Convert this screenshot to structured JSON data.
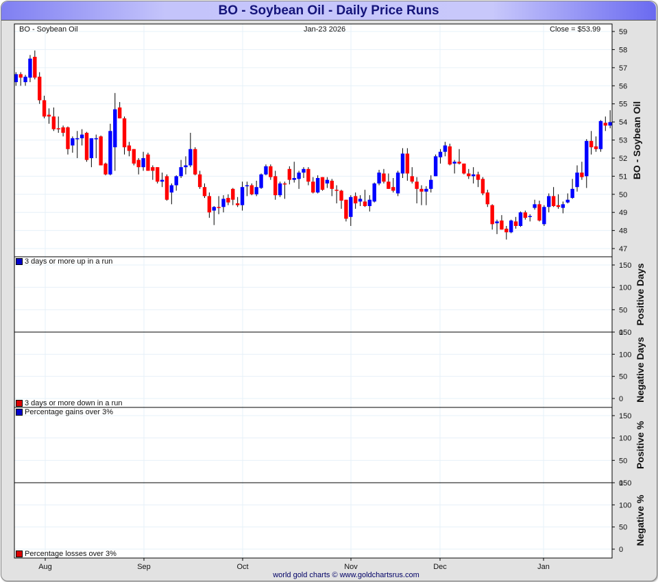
{
  "title": "BO  -  Soybean Oil - Daily Price Runs",
  "footer": "world gold charts © www.goldchartsrus.com",
  "chart_data": [
    {
      "type": "candlestick",
      "header_left": "BO  -  Soybean Oil",
      "header_center": "Jan-23  2026",
      "header_right": "Close = $53.99",
      "ylabel": "BO  -  Soybean Oil",
      "ylim": [
        47,
        59
      ],
      "y_ticks": [
        "47",
        "48",
        "49",
        "50",
        "51",
        "52",
        "53",
        "54",
        "55",
        "56",
        "57",
        "58",
        "59"
      ],
      "x_ticks": [
        "Aug",
        "Sep",
        "Oct",
        "Nov",
        "Dec",
        "Jan"
      ],
      "grid": true,
      "colors": {
        "up": "#0000ff",
        "down": "#ff0000",
        "grid": "#e6f0f8"
      },
      "ohlc": [
        [
          56.2,
          56.75,
          56.0,
          56.64
        ],
        [
          56.64,
          56.75,
          56.0,
          56.45
        ],
        [
          56.2,
          56.6,
          56.0,
          56.5
        ],
        [
          56.45,
          57.7,
          56.2,
          57.5
        ],
        [
          57.6,
          57.95,
          56.35,
          56.45
        ],
        [
          56.5,
          56.75,
          55.0,
          55.2
        ],
        [
          55.2,
          55.45,
          54.2,
          54.3
        ],
        [
          54.4,
          54.75,
          53.9,
          54.3
        ],
        [
          54.3,
          54.8,
          53.5,
          53.6
        ],
        [
          53.65,
          54.3,
          53.4,
          53.6
        ],
        [
          53.7,
          53.8,
          53.2,
          53.4
        ],
        [
          53.7,
          53.75,
          52.2,
          52.5
        ],
        [
          52.7,
          53.2,
          52.3,
          53.1
        ],
        [
          53.1,
          53.5,
          52.0,
          53.1
        ],
        [
          53.1,
          53.6,
          52.7,
          53.3
        ],
        [
          53.4,
          53.45,
          51.8,
          51.9
        ],
        [
          52.0,
          53.1,
          51.5,
          53.1
        ],
        [
          53.1,
          53.3,
          52.0,
          53.1
        ],
        [
          53.2,
          53.25,
          51.6,
          51.6
        ],
        [
          51.7,
          51.75,
          51.05,
          51.1
        ],
        [
          51.1,
          53.9,
          51.05,
          53.5
        ],
        [
          52.6,
          55.6,
          51.3,
          54.7
        ],
        [
          54.8,
          55.1,
          54.2,
          54.2
        ],
        [
          54.2,
          54.3,
          52.2,
          52.6
        ],
        [
          52.7,
          52.9,
          52.1,
          52.4
        ],
        [
          52.5,
          52.5,
          51.6,
          51.7
        ],
        [
          51.9,
          52.0,
          51.1,
          51.5
        ],
        [
          51.5,
          52.35,
          51.3,
          52.0
        ],
        [
          52.2,
          52.3,
          51.3,
          51.3
        ],
        [
          51.5,
          51.6,
          50.8,
          51.3
        ],
        [
          51.5,
          51.5,
          50.6,
          50.7
        ],
        [
          50.7,
          51.2,
          50.4,
          50.8
        ],
        [
          51.0,
          51.1,
          49.65,
          49.7
        ],
        [
          50.1,
          50.6,
          49.45,
          50.5
        ],
        [
          50.5,
          51.05,
          50.2,
          51.0
        ],
        [
          51.0,
          51.9,
          50.9,
          51.5
        ],
        [
          51.5,
          52.1,
          51.1,
          51.6
        ],
        [
          51.6,
          53.4,
          51.5,
          52.5
        ],
        [
          52.5,
          52.6,
          51.05,
          51.1
        ],
        [
          51.1,
          51.3,
          50.3,
          50.4
        ],
        [
          50.4,
          50.6,
          49.8,
          49.9
        ],
        [
          49.9,
          50.1,
          48.7,
          49.0
        ],
        [
          49.1,
          49.35,
          48.3,
          49.3
        ],
        [
          49.3,
          49.9,
          48.9,
          49.25
        ],
        [
          49.3,
          49.95,
          49.0,
          49.75
        ],
        [
          49.8,
          50.0,
          49.4,
          49.55
        ],
        [
          50.3,
          50.35,
          49.4,
          49.7
        ],
        [
          49.5,
          49.85,
          49.3,
          49.4
        ],
        [
          49.4,
          50.7,
          49.1,
          50.4
        ],
        [
          50.45,
          50.7,
          49.9,
          50.5
        ],
        [
          50.5,
          50.6,
          49.95,
          50.0
        ],
        [
          50.0,
          50.75,
          49.9,
          50.4
        ],
        [
          50.35,
          51.15,
          50.3,
          51.1
        ],
        [
          51.1,
          51.65,
          51.05,
          51.55
        ],
        [
          51.55,
          51.65,
          50.8,
          50.95
        ],
        [
          51.0,
          51.3,
          49.7,
          49.95
        ],
        [
          49.95,
          50.7,
          49.85,
          50.6
        ],
        [
          50.6,
          50.7,
          49.75,
          50.55
        ],
        [
          51.4,
          51.55,
          50.55,
          50.8
        ],
        [
          50.8,
          51.8,
          50.65,
          50.9
        ],
        [
          50.85,
          51.3,
          50.3,
          51.2
        ],
        [
          51.2,
          51.5,
          50.9,
          51.4
        ],
        [
          51.4,
          51.5,
          50.5,
          50.7
        ],
        [
          50.7,
          50.95,
          50.05,
          50.1
        ],
        [
          50.1,
          51.05,
          50.05,
          50.9
        ],
        [
          50.95,
          50.95,
          50.2,
          50.25
        ],
        [
          50.6,
          50.95,
          50.35,
          50.8
        ],
        [
          50.75,
          50.85,
          49.9,
          50.3
        ],
        [
          50.25,
          50.5,
          49.5,
          50.2
        ],
        [
          50.2,
          50.25,
          49.2,
          49.65
        ],
        [
          49.7,
          49.7,
          48.5,
          48.65
        ],
        [
          48.75,
          49.95,
          48.25,
          49.85
        ],
        [
          49.9,
          50.1,
          49.2,
          49.5
        ],
        [
          49.6,
          49.95,
          49.35,
          49.75
        ],
        [
          49.6,
          50.25,
          49.3,
          49.35
        ],
        [
          49.35,
          49.95,
          49.05,
          49.7
        ],
        [
          49.6,
          50.65,
          49.55,
          50.6
        ],
        [
          50.6,
          51.35,
          50.5,
          51.2
        ],
        [
          51.15,
          51.4,
          50.6,
          50.7
        ],
        [
          50.7,
          51.15,
          50.3,
          50.3
        ],
        [
          50.4,
          50.9,
          50.1,
          50.2
        ],
        [
          50.05,
          51.3,
          49.9,
          51.2
        ],
        [
          51.15,
          52.55,
          50.9,
          52.25
        ],
        [
          52.25,
          52.55,
          50.75,
          51.15
        ],
        [
          51.0,
          51.5,
          50.6,
          50.7
        ],
        [
          50.7,
          50.95,
          49.5,
          50.3
        ],
        [
          50.3,
          50.5,
          49.4,
          50.15
        ],
        [
          50.15,
          50.45,
          49.4,
          50.3
        ],
        [
          50.3,
          51.05,
          50.1,
          50.8
        ],
        [
          51.0,
          52.2,
          51.0,
          52.1
        ],
        [
          52.05,
          52.5,
          51.7,
          52.35
        ],
        [
          52.35,
          52.9,
          52.1,
          52.7
        ],
        [
          52.65,
          52.8,
          51.6,
          51.65
        ],
        [
          51.7,
          51.9,
          51.15,
          51.8
        ],
        [
          51.8,
          52.5,
          51.65,
          51.7
        ],
        [
          51.7,
          51.7,
          51.1,
          51.15
        ],
        [
          51.15,
          51.4,
          50.85,
          51.0
        ],
        [
          51.0,
          51.5,
          50.6,
          51.1
        ],
        [
          51.1,
          51.25,
          50.4,
          50.8
        ],
        [
          50.85,
          50.95,
          49.95,
          50.05
        ],
        [
          50.1,
          50.25,
          49.3,
          49.45
        ],
        [
          49.4,
          49.45,
          48.05,
          48.35
        ],
        [
          48.4,
          48.6,
          47.8,
          48.5
        ],
        [
          48.55,
          48.85,
          48.05,
          48.05
        ],
        [
          48.1,
          48.25,
          47.5,
          47.9
        ],
        [
          47.9,
          48.6,
          47.85,
          48.55
        ],
        [
          48.5,
          48.75,
          48.1,
          48.25
        ],
        [
          48.25,
          49.05,
          48.2,
          49.0
        ],
        [
          49.0,
          49.1,
          48.6,
          48.7
        ],
        [
          48.8,
          48.9,
          48.5,
          48.8
        ],
        [
          49.25,
          49.7,
          49.15,
          49.45
        ],
        [
          49.45,
          49.65,
          48.5,
          48.55
        ],
        [
          48.35,
          49.4,
          48.25,
          49.3
        ],
        [
          49.3,
          50.05,
          49.0,
          49.9
        ],
        [
          49.9,
          50.4,
          49.3,
          49.35
        ],
        [
          49.4,
          50.0,
          49.2,
          49.3
        ],
        [
          49.25,
          49.6,
          48.95,
          49.45
        ],
        [
          49.55,
          50.05,
          49.5,
          49.7
        ],
        [
          49.8,
          50.85,
          49.75,
          50.3
        ],
        [
          50.4,
          51.6,
          50.15,
          51.2
        ],
        [
          51.2,
          51.8,
          50.8,
          50.95
        ],
        [
          51.0,
          53.05,
          50.35,
          52.95
        ],
        [
          52.95,
          53.5,
          52.2,
          52.6
        ],
        [
          52.65,
          53.2,
          52.35,
          52.5
        ],
        [
          52.5,
          54.1,
          52.35,
          54.05
        ],
        [
          53.95,
          54.3,
          53.5,
          53.8
        ],
        [
          53.8,
          54.65,
          53.65,
          53.99
        ]
      ]
    },
    {
      "type": "bar",
      "ylabel": "Positive Days",
      "legend": "3 days or more up in a run",
      "legend_color": "#0000cc",
      "y_ticks": [
        "0",
        "50",
        "100",
        "150"
      ],
      "ylim": [
        0,
        150
      ],
      "values": []
    },
    {
      "type": "bar",
      "ylabel": "Negative Days",
      "legend": "3 days or more down in a run",
      "legend_color": "#dd0000",
      "y_ticks": [
        "0",
        "50",
        "100",
        "150"
      ],
      "ylim": [
        0,
        150
      ],
      "values": []
    },
    {
      "type": "bar",
      "ylabel": "Positive %",
      "legend": "Percentage gains over 3%",
      "legend_color": "#0000cc",
      "y_ticks": [
        "0",
        "50",
        "100",
        "150"
      ],
      "ylim": [
        0,
        150
      ],
      "values": []
    },
    {
      "type": "bar",
      "ylabel": "Negative %",
      "legend": "Percentage losses over 3%",
      "legend_color": "#dd0000",
      "y_ticks": [
        "0",
        "50",
        "100",
        "150"
      ],
      "ylim": [
        0,
        150
      ],
      "values": []
    }
  ]
}
